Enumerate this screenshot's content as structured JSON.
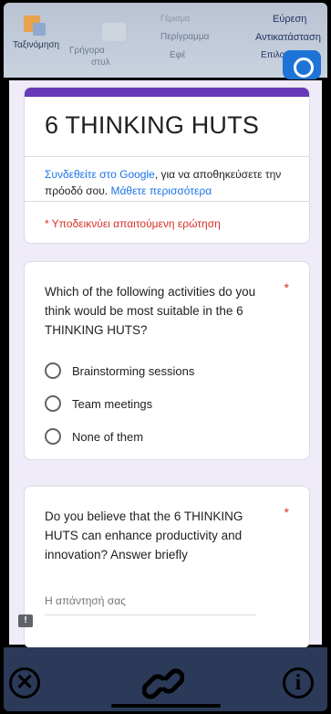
{
  "ribbon": {
    "sort_label": "Ταξινόμηση",
    "quick_label_1": "Γρήγορα",
    "quick_label_2": "στυλ",
    "fill_label": "Γέμισμα",
    "outline_label": "Περίγραμμα",
    "effect_label": "Εφέ",
    "find_label": "Εύρεση",
    "replace_label": "Αντικατάσταση",
    "select_label": "Επιλογή"
  },
  "form": {
    "title": "6 THINKING HUTS",
    "signin_link": "Συνδεθείτε στο Google",
    "signin_text": ", για να αποθηκεύσετε την πρόοδό σου.",
    "learn_more": "Μάθετε περισσότερα",
    "required_note": "* Υποδεικνύει απαιτούμενη ερώτηση",
    "questions": [
      {
        "title": "Which of the following activities do you think would be most suitable in the 6 THINKING HUTS?",
        "required_mark": "*",
        "options": [
          "Brainstorming sessions",
          "Team meetings",
          "None of them"
        ]
      },
      {
        "title": "Do you believe that the 6 THINKING HUTS can enhance productivity and innovation? Answer briefly",
        "required_mark": "*",
        "answer_placeholder": "Η απάντησή σας"
      }
    ]
  },
  "bottom_bar": {
    "close_icon": "close-circle-icon",
    "link_icon": "link-icon",
    "info_icon": "info-circle-icon",
    "close_glyph": "✕",
    "info_glyph": "i"
  },
  "feedback_glyph": "!",
  "colors": {
    "accent": "#673ab7",
    "link": "#1a73e8",
    "required": "#d93025",
    "form_background": "#f0ebf8",
    "bottom_bar": "#2b3a58"
  }
}
